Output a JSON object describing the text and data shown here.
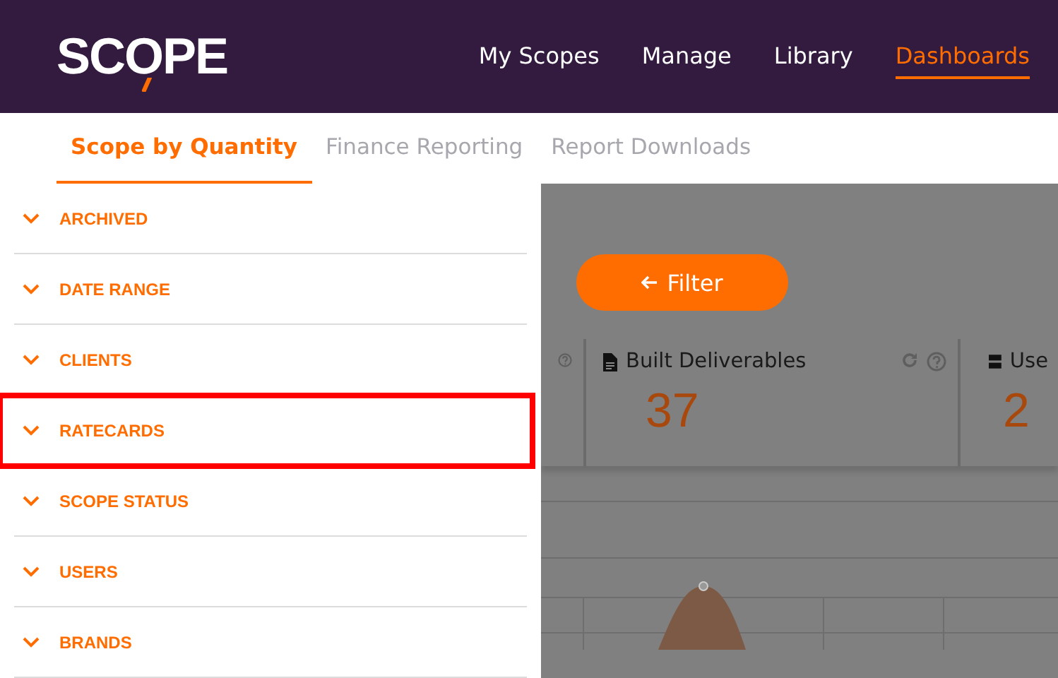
{
  "header": {
    "logo": "SCOPE",
    "nav": [
      {
        "label": "My Scopes",
        "selected": false
      },
      {
        "label": "Manage",
        "selected": false
      },
      {
        "label": "Library",
        "selected": false
      },
      {
        "label": "Dashboards",
        "selected": true
      }
    ]
  },
  "tabs": [
    {
      "label": "Scope by Quantity",
      "selected": true
    },
    {
      "label": "Finance Reporting",
      "selected": false
    },
    {
      "label": "Report Downloads",
      "selected": false
    }
  ],
  "filters": [
    {
      "label": "ARCHIVED",
      "highlighted": false
    },
    {
      "label": "DATE RANGE",
      "highlighted": false
    },
    {
      "label": "CLIENTS",
      "highlighted": false
    },
    {
      "label": "RATECARDS",
      "highlighted": true
    },
    {
      "label": "SCOPE STATUS",
      "highlighted": false
    },
    {
      "label": "USERS",
      "highlighted": false
    },
    {
      "label": "BRANDS",
      "highlighted": false
    }
  ],
  "filter_button": {
    "label": "Filter"
  },
  "stats": [
    {
      "kind": "partial"
    },
    {
      "kind": "document",
      "title": "Built Deliverables",
      "value": "37",
      "refresh": true
    },
    {
      "kind": "stack",
      "title": "Use",
      "value": "2"
    }
  ]
}
